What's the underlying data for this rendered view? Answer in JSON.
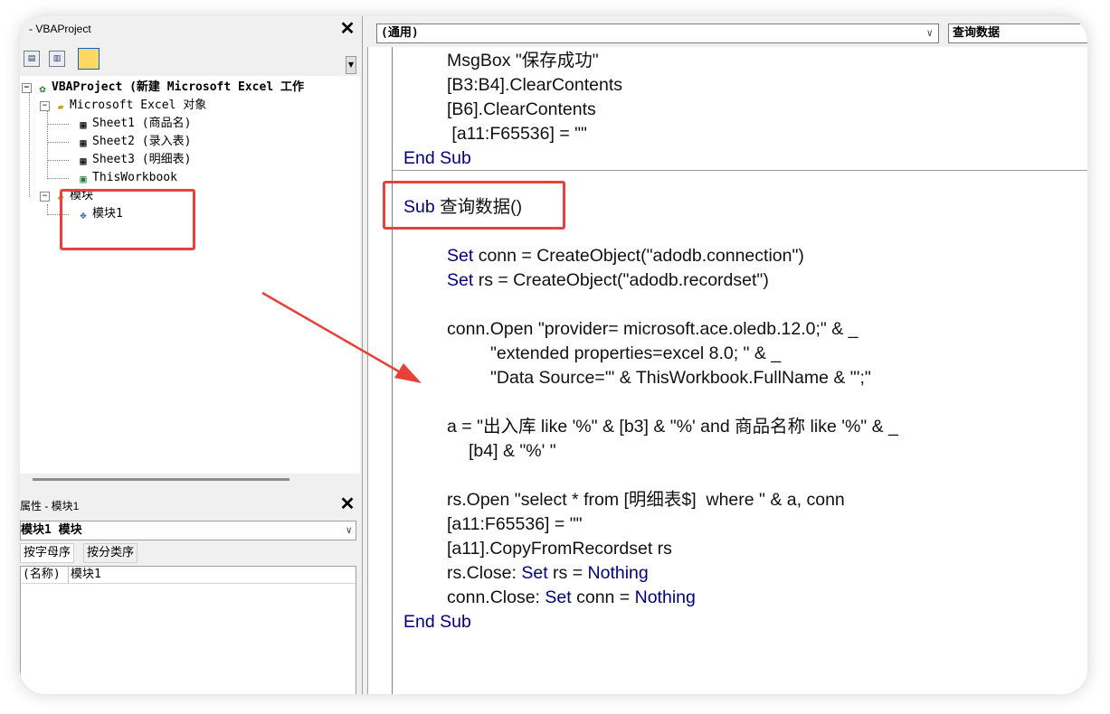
{
  "project_panel": {
    "title": "- VBAProject",
    "tree": {
      "root": "VBAProject (新建 Microsoft Excel 工作",
      "group_excel": "Microsoft Excel 对象",
      "sheets": [
        "Sheet1 (商品名)",
        "Sheet2 (录入表)",
        "Sheet3 (明细表)"
      ],
      "workbook": "ThisWorkbook",
      "group_modules": "模块",
      "module": "模块1"
    }
  },
  "properties_panel": {
    "title": "属性 - 模块1",
    "object_select": "模块1 模块",
    "tabs": [
      "按字母序",
      "按分类序"
    ],
    "rows": [
      {
        "name": "(名称)",
        "value": "模块1"
      }
    ]
  },
  "code_window": {
    "object_combo": "(通用)",
    "procedure_combo": "查询数据",
    "lines": [
      {
        "indent": 4,
        "parts": [
          {
            "t": "MsgBox \"保存成功\""
          }
        ]
      },
      {
        "indent": 4,
        "parts": [
          {
            "t": "[B3:B4].ClearContents"
          }
        ]
      },
      {
        "indent": 4,
        "parts": [
          {
            "t": "[B6].ClearContents"
          }
        ]
      },
      {
        "indent": 4,
        "parts": [
          {
            "t": " [a11:F65536] = \"\""
          }
        ]
      },
      {
        "indent": 0,
        "parts": [
          {
            "t": "End Sub",
            "kw": true
          }
        ]
      },
      {
        "indent": 0,
        "parts": [
          {
            "t": ""
          }
        ]
      },
      {
        "indent": 0,
        "parts": [
          {
            "t": "Sub",
            "kw": true
          },
          {
            "t": " 查询数据()"
          }
        ]
      },
      {
        "indent": 0,
        "parts": [
          {
            "t": ""
          }
        ]
      },
      {
        "indent": 4,
        "parts": [
          {
            "t": "Set",
            "kw": true
          },
          {
            "t": " conn = CreateObject(\"adodb.connection\")"
          }
        ]
      },
      {
        "indent": 4,
        "parts": [
          {
            "t": "Set",
            "kw": true
          },
          {
            "t": " rs = CreateObject(\"adodb.recordset\")"
          }
        ]
      },
      {
        "indent": 0,
        "parts": [
          {
            "t": ""
          }
        ]
      },
      {
        "indent": 4,
        "parts": [
          {
            "t": "conn.Open \"provider= microsoft.ace.oledb.12.0;\" & _"
          }
        ]
      },
      {
        "indent": 8,
        "parts": [
          {
            "t": "\"extended properties=excel 8.0; \" & _"
          }
        ]
      },
      {
        "indent": 8,
        "parts": [
          {
            "t": "\"Data Source='\" & ThisWorkbook.FullName & \"';\""
          }
        ]
      },
      {
        "indent": 0,
        "parts": [
          {
            "t": ""
          }
        ]
      },
      {
        "indent": 4,
        "parts": [
          {
            "t": "a = \"出入库 like '%\" & [b3] & \"%' and 商品名称 like '%\" & _"
          }
        ]
      },
      {
        "indent": 6,
        "parts": [
          {
            "t": "[b4] & \"%' \""
          }
        ]
      },
      {
        "indent": 0,
        "parts": [
          {
            "t": ""
          }
        ]
      },
      {
        "indent": 4,
        "parts": [
          {
            "t": "rs.Open \"select * from [明细表$]  where \" & a, conn"
          }
        ]
      },
      {
        "indent": 4,
        "parts": [
          {
            "t": "[a11:F65536] = \"\""
          }
        ]
      },
      {
        "indent": 4,
        "parts": [
          {
            "t": "[a11].CopyFromRecordset rs"
          }
        ]
      },
      {
        "indent": 4,
        "parts": [
          {
            "t": "rs.Close: "
          },
          {
            "t": "Set",
            "kw": true
          },
          {
            "t": " rs = "
          },
          {
            "t": "Nothing",
            "kw": true
          }
        ]
      },
      {
        "indent": 4,
        "parts": [
          {
            "t": "conn.Close: "
          },
          {
            "t": "Set",
            "kw": true
          },
          {
            "t": " conn = "
          },
          {
            "t": "Nothing",
            "kw": true
          }
        ]
      },
      {
        "indent": 0,
        "parts": [
          {
            "t": "End Sub",
            "kw": true
          }
        ]
      }
    ]
  },
  "colors": {
    "keyword": "#00007f",
    "annotation": "#e8413a"
  }
}
